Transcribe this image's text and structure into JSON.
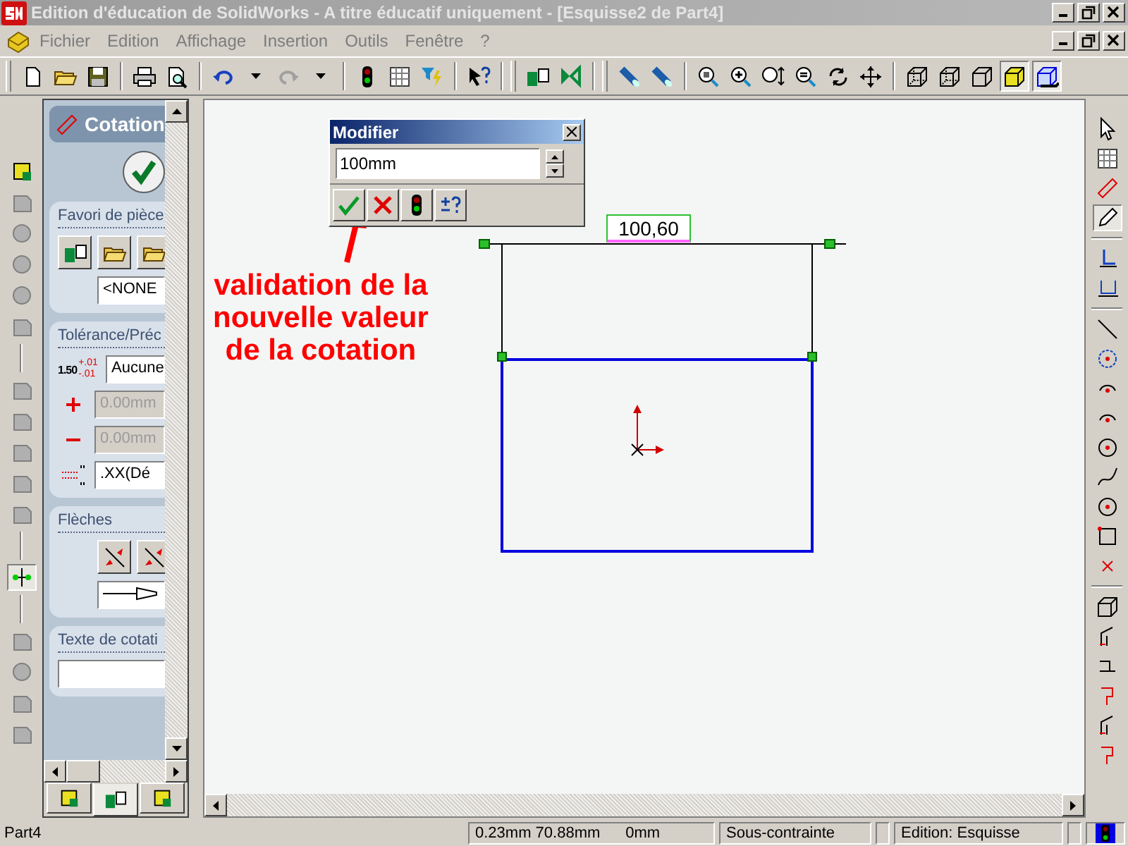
{
  "window": {
    "title": "Edition d'éducation de SolidWorks - A titre éducatif uniquement - [Esquisse2 de Part4]"
  },
  "menu": [
    "Fichier",
    "Edition",
    "Affichage",
    "Insertion",
    "Outils",
    "Fenêtre",
    "?"
  ],
  "property_manager": {
    "title": "Cotation",
    "favorites": {
      "title": "Favori de pièce",
      "value": "<NONE"
    },
    "tolerance": {
      "title": "Tolérance/Préc",
      "sample": "1.50",
      "upper": "+.01",
      "lower": "-.01",
      "type": "Aucune",
      "plus": "0.00mm",
      "minus": "0.00mm",
      "precision": ".XX(Dé"
    },
    "arrows": {
      "title": "Flèches"
    },
    "text": {
      "title": "Texte de cotati"
    },
    "tabs": [
      {
        "selected": false
      },
      {
        "selected": true
      },
      {
        "selected": false
      }
    ]
  },
  "modifier": {
    "title": "Modifier",
    "value": "100mm"
  },
  "sketch": {
    "dimension": "100,60"
  },
  "annotation": [
    "validation de la",
    "nouvelle valeur",
    "de la cotation"
  ],
  "status_bar": {
    "document": "Part4",
    "coordinates": "0.23mm 70.88mm",
    "z": "0mm",
    "constraint": "Sous-contrainte",
    "mode": "Edition: Esquisse"
  }
}
